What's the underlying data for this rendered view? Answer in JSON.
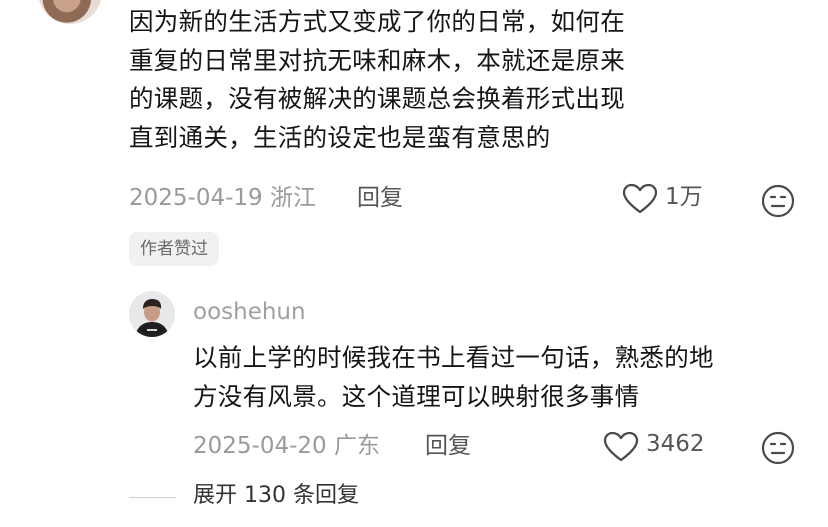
{
  "comment": {
    "lines": [
      "因为新的生活方式又变成了你的日常，如何在",
      "重复的日常里对抗无味和麻木，本就还是原来",
      "的课题，没有被解决的课题总会换着形式出现",
      "直到通关，生活的设定也是蛮有意思的"
    ],
    "date_location": "2025-04-19 浙江",
    "reply_label": "回复",
    "like_count": "1万",
    "author_liked_badge": "作者赞过"
  },
  "reply": {
    "username": "ooshehun",
    "lines": [
      "以前上学的时候我在书上看过一句话，熟悉的地",
      "方没有风景。这个道理可以映射很多事情"
    ],
    "date_location": "2025-04-20 广东",
    "reply_label": "回复",
    "like_count": "3462"
  },
  "expand_replies": "展开 130 条回复",
  "icons": {
    "like": "heart-outline-icon",
    "dislike": "meh-face-icon"
  }
}
